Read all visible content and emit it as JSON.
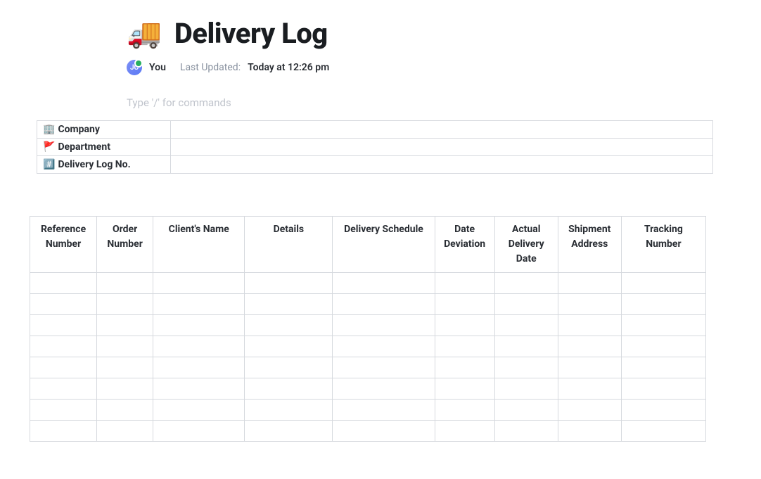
{
  "header": {
    "icon": "🚚",
    "title": "Delivery Log"
  },
  "meta": {
    "avatar_initials": "JC",
    "author": "You",
    "last_updated_label": "Last Updated:",
    "last_updated_value": "Today at 12:26 pm"
  },
  "commands_placeholder": "Type '/' for commands",
  "info_table": {
    "rows": [
      {
        "emoji": "🏢",
        "label": "Company",
        "value": ""
      },
      {
        "emoji": "🚩",
        "label": "Department",
        "value": ""
      },
      {
        "emoji": "#️⃣",
        "label": "Delivery Log No.",
        "value": ""
      }
    ]
  },
  "log_table": {
    "headers": [
      "Reference Number",
      "Order Number",
      "Client's Name",
      "Details",
      "Delivery Schedule",
      "Date Deviation",
      "Actual Delivery Date",
      "Shipment Address",
      "Tracking Number"
    ],
    "row_count": 8
  }
}
